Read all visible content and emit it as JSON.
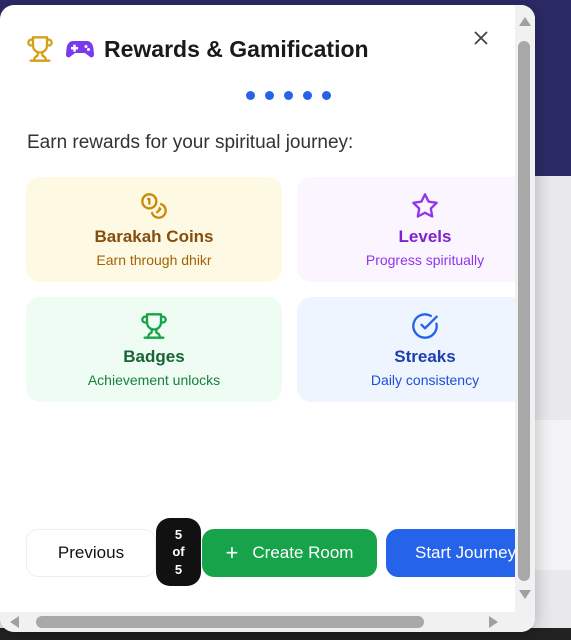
{
  "modal": {
    "title": "Rewards & Gamification",
    "intro": "Earn rewards for your spiritual journey:",
    "close_label": "×",
    "step_count": 5,
    "cards": [
      {
        "title": "Barakah Coins",
        "subtitle": "Earn through dhikr",
        "icon": "coins-icon",
        "bg": "#fef9e3",
        "title_color": "#854d0e",
        "subtitle_color": "#a16207",
        "icon_color": "#ca8a04"
      },
      {
        "title": "Levels",
        "subtitle": "Progress spiritually",
        "icon": "star-icon",
        "bg": "#fbf5ff",
        "title_color": "#7e22ce",
        "subtitle_color": "#9333ea",
        "icon_color": "#9333ea"
      },
      {
        "title": "Badges",
        "subtitle": "Achievement unlocks",
        "icon": "trophy-icon",
        "bg": "#effcf3",
        "title_color": "#166534",
        "subtitle_color": "#15803d",
        "icon_color": "#16a34a"
      },
      {
        "title": "Streaks",
        "subtitle": "Daily consistency",
        "icon": "check-circle-icon",
        "bg": "#eff5ff",
        "title_color": "#1e40af",
        "subtitle_color": "#1d4ed8",
        "icon_color": "#2563eb"
      }
    ],
    "pager": {
      "current": "5",
      "of": "of",
      "total": "5"
    },
    "buttons": {
      "previous": "Previous",
      "create_room": "Create Room",
      "start_journey": "Start Journey"
    }
  },
  "colors": {
    "accent_blue": "#2563eb",
    "accent_green": "#16a34a",
    "trophy_gold": "#d4a017"
  }
}
